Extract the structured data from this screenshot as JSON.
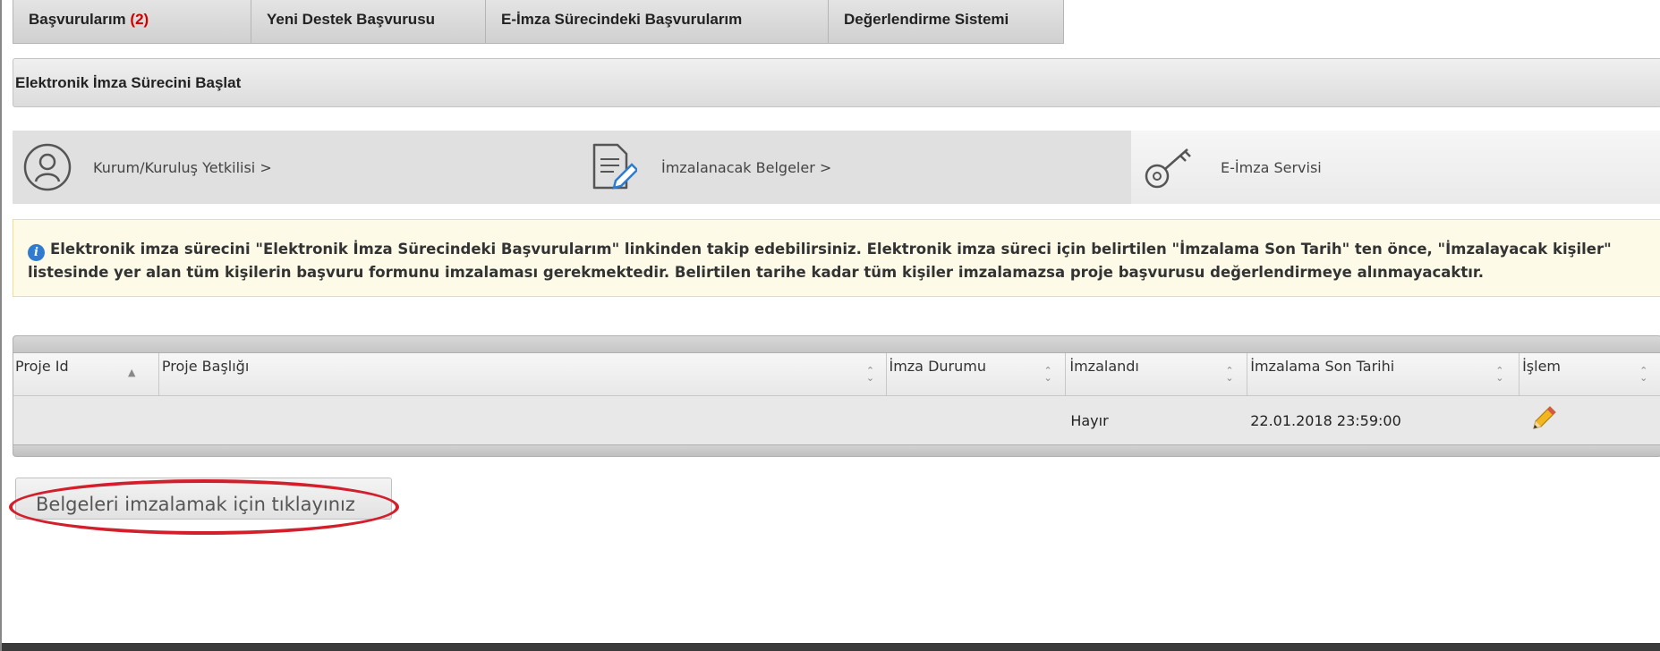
{
  "tabs": [
    {
      "label": "Başvurularım",
      "count": "(2)"
    },
    {
      "label": "Yeni Destek Başvurusu"
    },
    {
      "label": "E-İmza Sürecindeki Başvurularım"
    },
    {
      "label": "Değerlendirme Sistemi"
    }
  ],
  "title_bar": {
    "label": "Elektronik İmza Sürecini Başlat"
  },
  "steps": [
    {
      "label": "Kurum/Kuruluş Yetkilisi >",
      "icon": "user-circle-icon"
    },
    {
      "label": "İmzalanacak Belgeler >",
      "icon": "document-edit-icon"
    },
    {
      "label": "E-İmza Servisi",
      "icon": "key-icon"
    }
  ],
  "info": {
    "icon": "info-icon",
    "text": "Elektronik imza sürecini \"Elektronik İmza Sürecindeki Başvurularım\" linkinden takip edebilirsiniz. Elektronik imza süreci için belirtilen \"İmzalama Son Tarih\" ten önce, \"İmzalayacak kişiler\" listesinde yer alan tüm kişilerin başvuru formunu imzalaması gerekmektedir. Belirtilen tarihe kadar tüm kişiler imzalamazsa proje başvurusu değerlendirmeye alınmayacaktır."
  },
  "grid": {
    "columns": [
      "Proje Id",
      "Proje Başlığı",
      "İmza Durumu",
      "İmzalandı",
      "İmzalama Son Tarihi",
      "İşlem"
    ],
    "rows": [
      {
        "proje_id": "",
        "proje_basligi": "",
        "imza_durumu": "",
        "imzalandi": "Hayır",
        "son_tarih": "22.01.2018 23:59:00",
        "islem_icon": "pencil-icon"
      }
    ]
  },
  "sign_button": {
    "label": "Belgeleri imzalamak için tıklayınız"
  },
  "colors": {
    "accent_red": "#d21f2b",
    "info_blue": "#2e7bcf",
    "info_bg": "#fdfbe8"
  }
}
